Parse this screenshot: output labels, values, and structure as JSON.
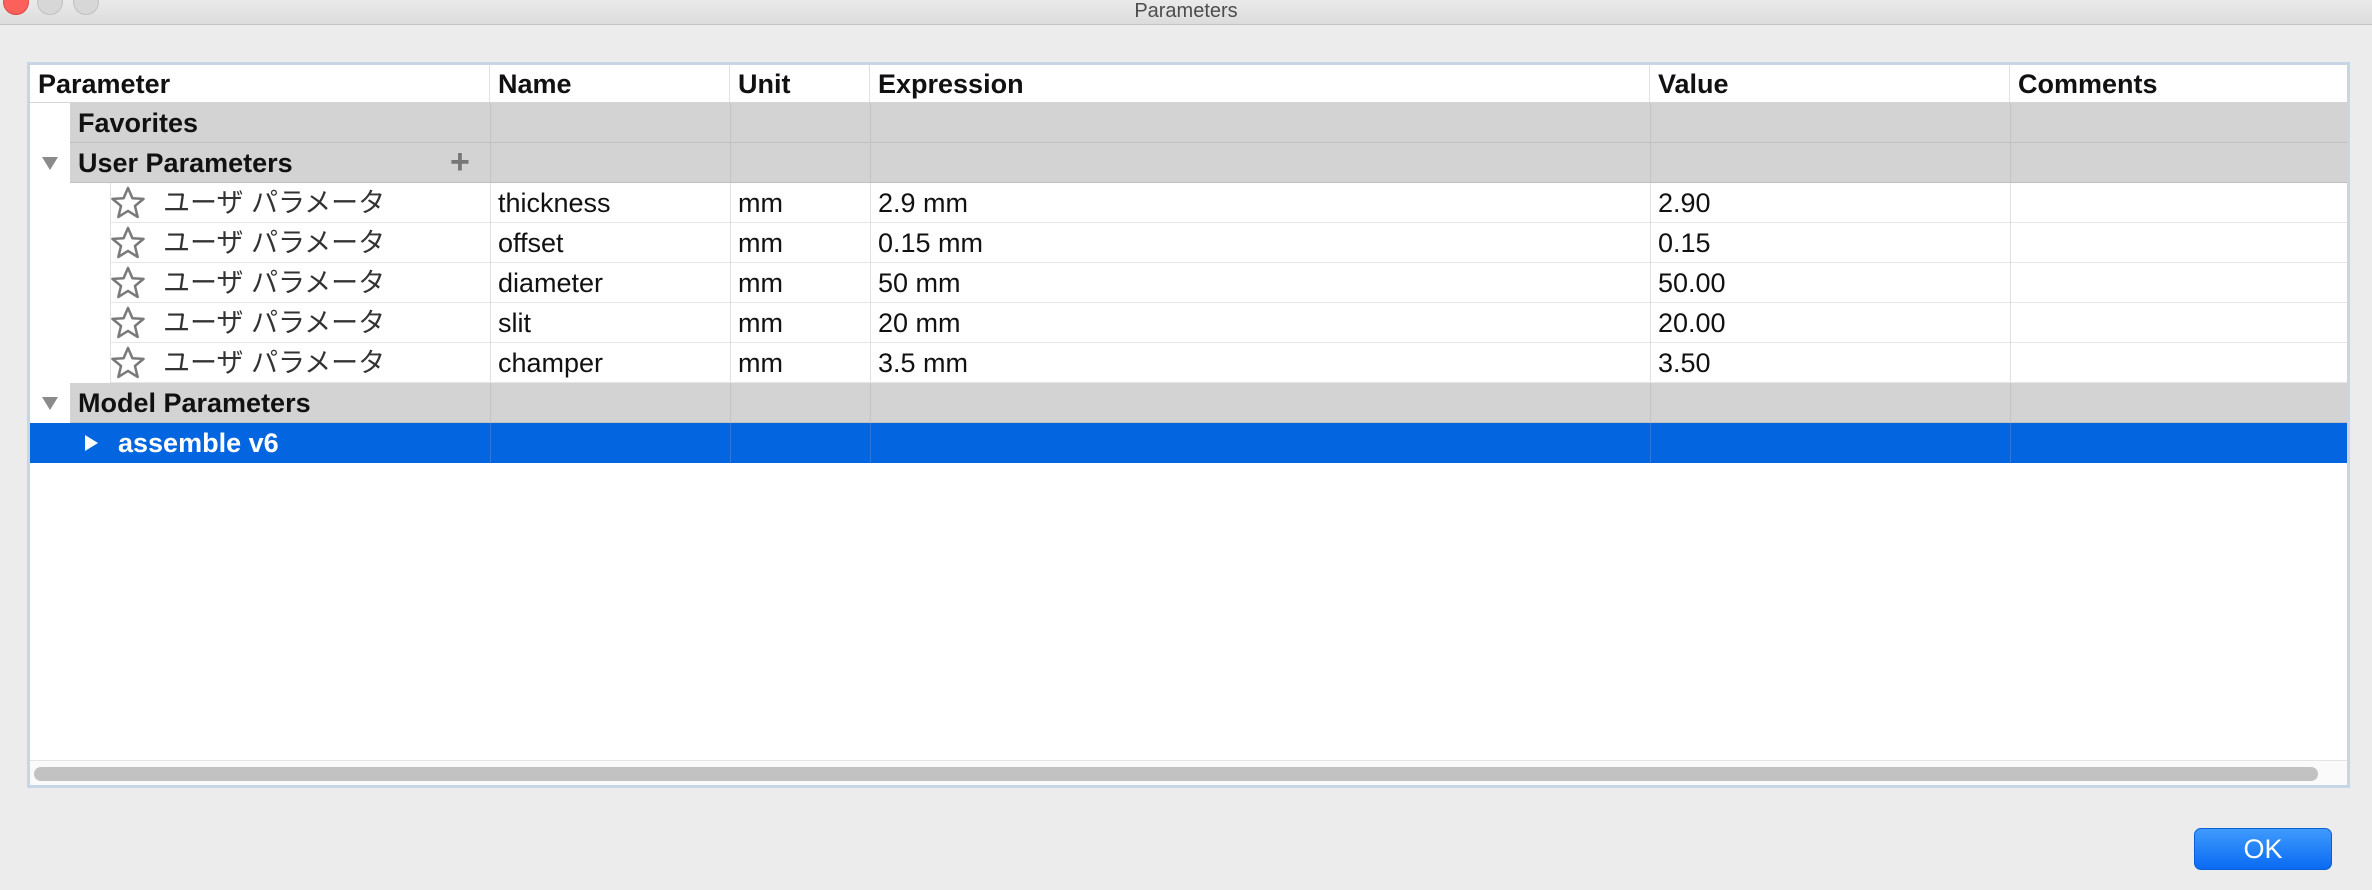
{
  "window": {
    "title": "Parameters"
  },
  "columns": [
    "Parameter",
    "Name",
    "Unit",
    "Expression",
    "Value",
    "Comments"
  ],
  "groups": {
    "favorites": "Favorites",
    "user": "User Parameters",
    "model": "Model Parameters"
  },
  "user_params": [
    {
      "type": "ユーザ パラメータ",
      "name": "thickness",
      "unit": "mm",
      "expression": "2.9 mm",
      "value": "2.90",
      "comment": ""
    },
    {
      "type": "ユーザ パラメータ",
      "name": "offset",
      "unit": "mm",
      "expression": "0.15 mm",
      "value": "0.15",
      "comment": ""
    },
    {
      "type": "ユーザ パラメータ",
      "name": "diameter",
      "unit": "mm",
      "expression": "50 mm",
      "value": "50.00",
      "comment": ""
    },
    {
      "type": "ユーザ パラメータ",
      "name": "slit",
      "unit": "mm",
      "expression": "20 mm",
      "value": "20.00",
      "comment": ""
    },
    {
      "type": "ユーザ パラメータ",
      "name": "champer",
      "unit": "mm",
      "expression": "3.5 mm",
      "value": "3.50",
      "comment": ""
    }
  ],
  "model_params": [
    {
      "label": "assemble v6",
      "selected": true
    }
  ],
  "buttons": {
    "ok": "OK"
  },
  "colors": {
    "selection": "#0465e0",
    "group_bg": "#d3d3d3",
    "ok_button": "#1a78f6"
  }
}
